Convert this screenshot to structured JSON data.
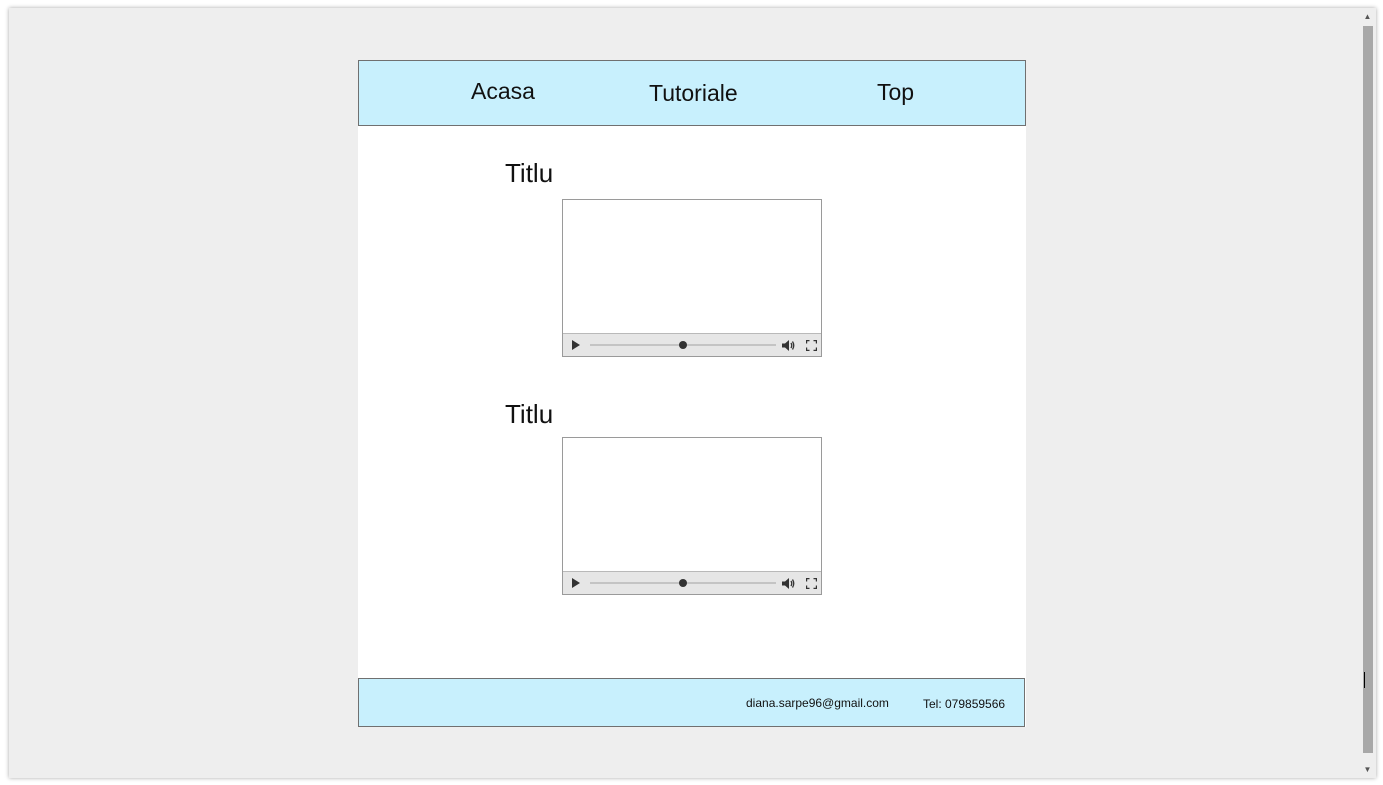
{
  "nav": {
    "items": [
      {
        "label": "Acasa"
      },
      {
        "label": "Tutoriale"
      },
      {
        "label": "Top"
      }
    ]
  },
  "videos": [
    {
      "title": "Titlu",
      "progress": 0.5
    },
    {
      "title": "Titlu",
      "progress": 0.5
    }
  ],
  "footer": {
    "email": "diana.sarpe96@gmail.com",
    "phone": "Tel: 079859566"
  },
  "scrollbar": {
    "up_icon": "arrow-up-icon",
    "down_icon": "arrow-down-icon",
    "up_glyph": "▲",
    "down_glyph": "▼"
  },
  "colors": {
    "header_bg": "#c8f0fd",
    "footer_bg": "#c8f0fd",
    "window_bg": "#eeeeee",
    "page_bg": "#ffffff"
  }
}
